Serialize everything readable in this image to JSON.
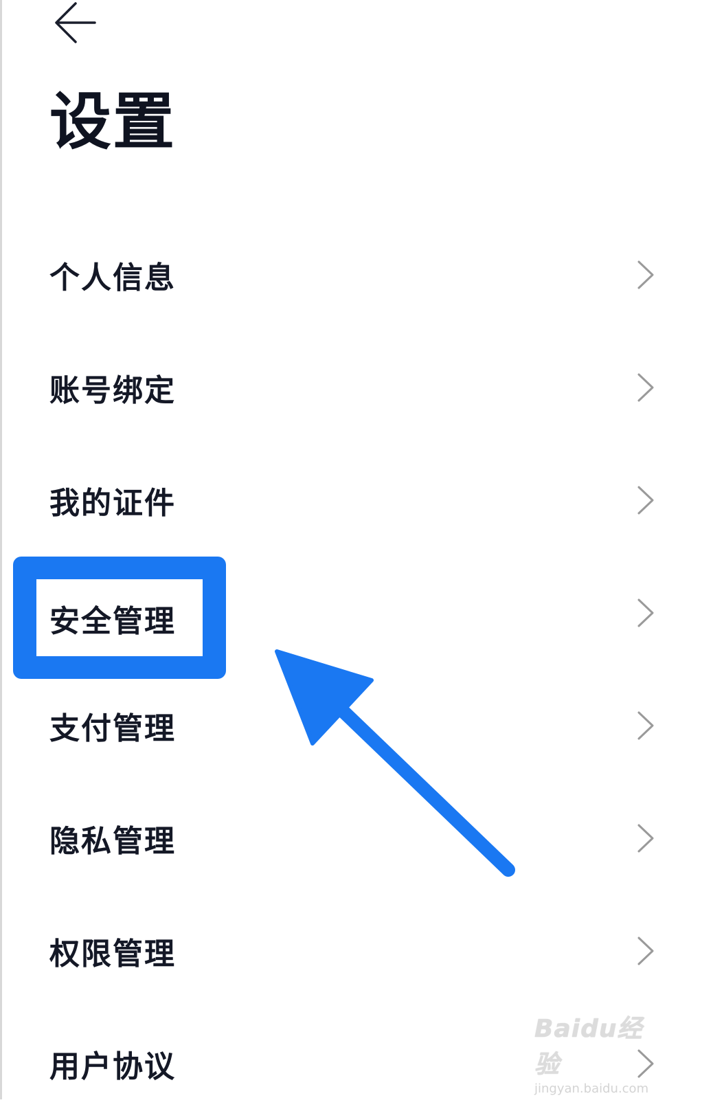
{
  "header": {
    "back_icon": "arrow-left-icon",
    "title": "设置"
  },
  "settings": {
    "items": [
      {
        "label": "个人信息",
        "icon": "chevron-right-icon"
      },
      {
        "label": "账号绑定",
        "icon": "chevron-right-icon"
      },
      {
        "label": "我的证件",
        "icon": "chevron-right-icon"
      },
      {
        "label": "安全管理",
        "icon": "chevron-right-icon"
      },
      {
        "label": "支付管理",
        "icon": "chevron-right-icon"
      },
      {
        "label": "隐私管理",
        "icon": "chevron-right-icon"
      },
      {
        "label": "权限管理",
        "icon": "chevron-right-icon"
      },
      {
        "label": "用户协议",
        "icon": "chevron-right-icon"
      }
    ]
  },
  "annotation": {
    "highlighted_item": "安全管理",
    "highlight_color": "#1a78f2",
    "arrow_color": "#1a78f2"
  },
  "watermark": {
    "logo": "Baidu经验",
    "url": "jingyan.baidu.com"
  },
  "colors": {
    "text": "#141826",
    "chevron": "#9a9a9a",
    "background": "#ffffff"
  }
}
